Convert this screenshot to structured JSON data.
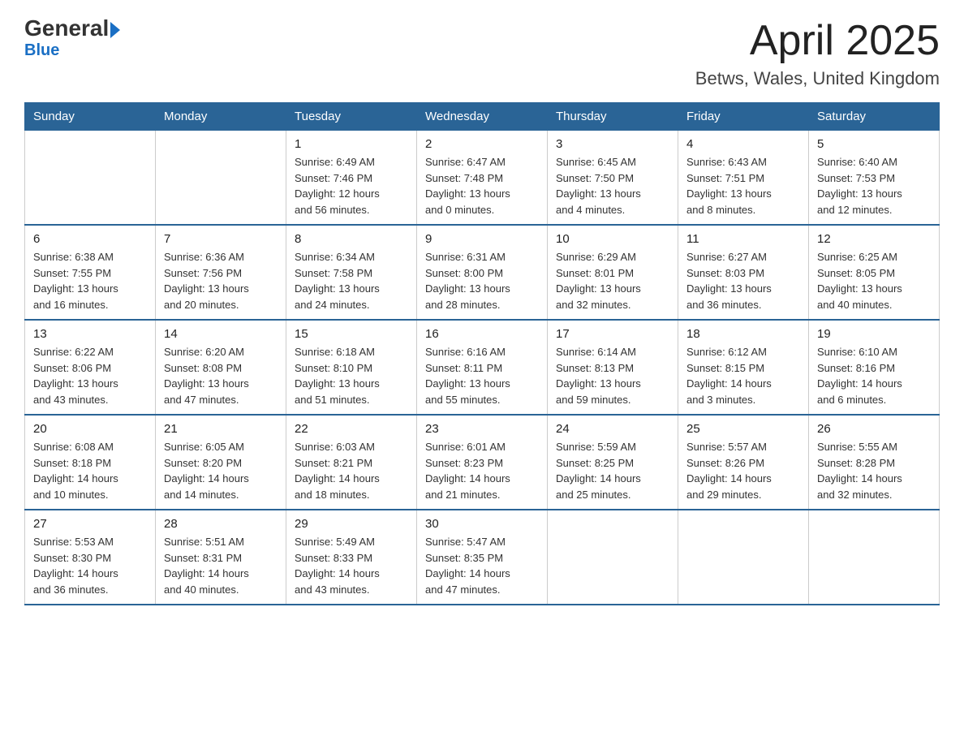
{
  "header": {
    "logo_line1": "General",
    "logo_line2": "Blue",
    "month_title": "April 2025",
    "location": "Betws, Wales, United Kingdom"
  },
  "weekdays": [
    "Sunday",
    "Monday",
    "Tuesday",
    "Wednesday",
    "Thursday",
    "Friday",
    "Saturday"
  ],
  "weeks": [
    [
      {
        "day": "",
        "info": ""
      },
      {
        "day": "",
        "info": ""
      },
      {
        "day": "1",
        "info": "Sunrise: 6:49 AM\nSunset: 7:46 PM\nDaylight: 12 hours\nand 56 minutes."
      },
      {
        "day": "2",
        "info": "Sunrise: 6:47 AM\nSunset: 7:48 PM\nDaylight: 13 hours\nand 0 minutes."
      },
      {
        "day": "3",
        "info": "Sunrise: 6:45 AM\nSunset: 7:50 PM\nDaylight: 13 hours\nand 4 minutes."
      },
      {
        "day": "4",
        "info": "Sunrise: 6:43 AM\nSunset: 7:51 PM\nDaylight: 13 hours\nand 8 minutes."
      },
      {
        "day": "5",
        "info": "Sunrise: 6:40 AM\nSunset: 7:53 PM\nDaylight: 13 hours\nand 12 minutes."
      }
    ],
    [
      {
        "day": "6",
        "info": "Sunrise: 6:38 AM\nSunset: 7:55 PM\nDaylight: 13 hours\nand 16 minutes."
      },
      {
        "day": "7",
        "info": "Sunrise: 6:36 AM\nSunset: 7:56 PM\nDaylight: 13 hours\nand 20 minutes."
      },
      {
        "day": "8",
        "info": "Sunrise: 6:34 AM\nSunset: 7:58 PM\nDaylight: 13 hours\nand 24 minutes."
      },
      {
        "day": "9",
        "info": "Sunrise: 6:31 AM\nSunset: 8:00 PM\nDaylight: 13 hours\nand 28 minutes."
      },
      {
        "day": "10",
        "info": "Sunrise: 6:29 AM\nSunset: 8:01 PM\nDaylight: 13 hours\nand 32 minutes."
      },
      {
        "day": "11",
        "info": "Sunrise: 6:27 AM\nSunset: 8:03 PM\nDaylight: 13 hours\nand 36 minutes."
      },
      {
        "day": "12",
        "info": "Sunrise: 6:25 AM\nSunset: 8:05 PM\nDaylight: 13 hours\nand 40 minutes."
      }
    ],
    [
      {
        "day": "13",
        "info": "Sunrise: 6:22 AM\nSunset: 8:06 PM\nDaylight: 13 hours\nand 43 minutes."
      },
      {
        "day": "14",
        "info": "Sunrise: 6:20 AM\nSunset: 8:08 PM\nDaylight: 13 hours\nand 47 minutes."
      },
      {
        "day": "15",
        "info": "Sunrise: 6:18 AM\nSunset: 8:10 PM\nDaylight: 13 hours\nand 51 minutes."
      },
      {
        "day": "16",
        "info": "Sunrise: 6:16 AM\nSunset: 8:11 PM\nDaylight: 13 hours\nand 55 minutes."
      },
      {
        "day": "17",
        "info": "Sunrise: 6:14 AM\nSunset: 8:13 PM\nDaylight: 13 hours\nand 59 minutes."
      },
      {
        "day": "18",
        "info": "Sunrise: 6:12 AM\nSunset: 8:15 PM\nDaylight: 14 hours\nand 3 minutes."
      },
      {
        "day": "19",
        "info": "Sunrise: 6:10 AM\nSunset: 8:16 PM\nDaylight: 14 hours\nand 6 minutes."
      }
    ],
    [
      {
        "day": "20",
        "info": "Sunrise: 6:08 AM\nSunset: 8:18 PM\nDaylight: 14 hours\nand 10 minutes."
      },
      {
        "day": "21",
        "info": "Sunrise: 6:05 AM\nSunset: 8:20 PM\nDaylight: 14 hours\nand 14 minutes."
      },
      {
        "day": "22",
        "info": "Sunrise: 6:03 AM\nSunset: 8:21 PM\nDaylight: 14 hours\nand 18 minutes."
      },
      {
        "day": "23",
        "info": "Sunrise: 6:01 AM\nSunset: 8:23 PM\nDaylight: 14 hours\nand 21 minutes."
      },
      {
        "day": "24",
        "info": "Sunrise: 5:59 AM\nSunset: 8:25 PM\nDaylight: 14 hours\nand 25 minutes."
      },
      {
        "day": "25",
        "info": "Sunrise: 5:57 AM\nSunset: 8:26 PM\nDaylight: 14 hours\nand 29 minutes."
      },
      {
        "day": "26",
        "info": "Sunrise: 5:55 AM\nSunset: 8:28 PM\nDaylight: 14 hours\nand 32 minutes."
      }
    ],
    [
      {
        "day": "27",
        "info": "Sunrise: 5:53 AM\nSunset: 8:30 PM\nDaylight: 14 hours\nand 36 minutes."
      },
      {
        "day": "28",
        "info": "Sunrise: 5:51 AM\nSunset: 8:31 PM\nDaylight: 14 hours\nand 40 minutes."
      },
      {
        "day": "29",
        "info": "Sunrise: 5:49 AM\nSunset: 8:33 PM\nDaylight: 14 hours\nand 43 minutes."
      },
      {
        "day": "30",
        "info": "Sunrise: 5:47 AM\nSunset: 8:35 PM\nDaylight: 14 hours\nand 47 minutes."
      },
      {
        "day": "",
        "info": ""
      },
      {
        "day": "",
        "info": ""
      },
      {
        "day": "",
        "info": ""
      }
    ]
  ]
}
